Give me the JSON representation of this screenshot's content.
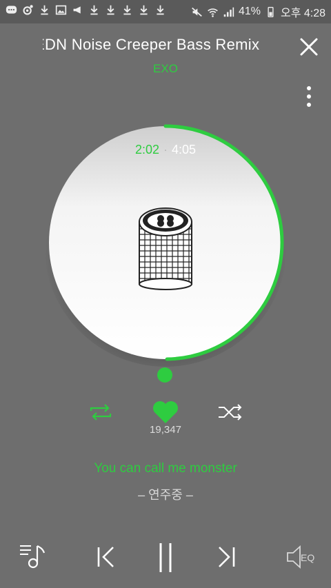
{
  "status_bar": {
    "battery": "41%",
    "time": "오후 4:28",
    "left_icons": [
      "chat-icon",
      "music-icon",
      "download-icon",
      "image-icon",
      "megaphone-icon",
      "download-icon",
      "download-icon",
      "download-icon",
      "download-icon",
      "download-icon"
    ],
    "right_icons": [
      "mute-icon",
      "wifi-icon",
      "signal-icon",
      "battery-icon"
    ]
  },
  "player": {
    "title": "EDN Noise Creeper Bass Remix",
    "artist": "EXO",
    "elapsed": "2:02",
    "separator": "·",
    "total": "4:05",
    "progress": 0.498,
    "likes": "19,347",
    "liked": true,
    "lyric_current": "You can call me monster",
    "lyric_next": "– 연주중 –"
  },
  "colors": {
    "accent": "#2ecc40",
    "background": "#6e6e6e",
    "disc": "#f2f2f2"
  }
}
